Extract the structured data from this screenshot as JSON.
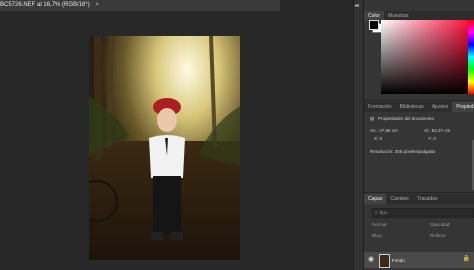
{
  "document": {
    "tab_title": "BC5726.NEF al 16,7% (RGB/16*)",
    "close_icon": "×"
  },
  "panels": {
    "color_tabs": [
      "Color",
      "Muestras"
    ],
    "properties_tabs": [
      "Formación",
      "Bibliotecas",
      "Ajustes",
      "Propiedades"
    ],
    "properties_title": "Propiedades del documento",
    "an_label": "An.: 47,58 cm",
    "al_label": "Al.: 83,37 cm",
    "x_label": "X: 0",
    "y_label": "Y: 0",
    "resolution": "Resolución: 305 píxeles/pulgada",
    "layers_tabs": [
      "Capas",
      "Canales",
      "Trazados"
    ],
    "search_placeholder": "Tipo",
    "blend_mode": "Normal",
    "opacity_label": "Opacidad:",
    "fill_label": "Relleno:",
    "lock_label": "Bloq.:",
    "layer_name": "Fondo",
    "lock_icon": "lock-icon",
    "eye_icon": "eye-icon"
  },
  "colors": {
    "app_bg": "#282828",
    "panel_bg": "#353535",
    "accent": "#ff0030"
  }
}
